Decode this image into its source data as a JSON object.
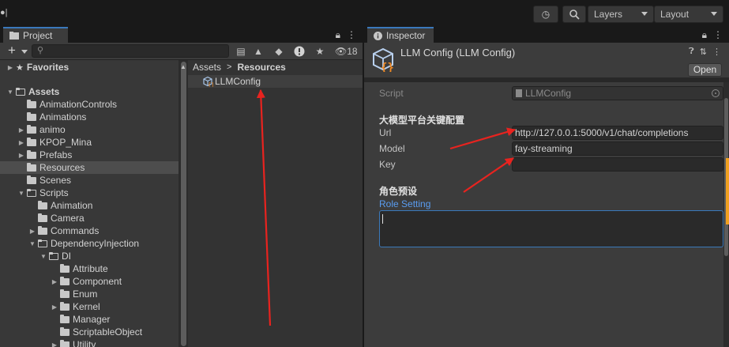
{
  "toolbar": {
    "left_glyph": "●|",
    "layers_label": "Layers",
    "layout_label": "Layout",
    "icons": [
      "history-icon",
      "search-icon"
    ]
  },
  "project": {
    "tab_label": "Project",
    "search_placeholder": "",
    "hidden_count": "18",
    "tree": [
      {
        "label": "Favorites",
        "level": 0,
        "expanded": false,
        "kind": "star",
        "bold": true
      },
      {
        "label": "Assets",
        "level": 0,
        "expanded": true,
        "kind": "folder-open",
        "bold": true
      },
      {
        "label": "AnimationControls",
        "level": 1,
        "kind": "folder"
      },
      {
        "label": "Animations",
        "level": 1,
        "kind": "folder"
      },
      {
        "label": "animo",
        "level": 1,
        "expanded": false,
        "kind": "folder"
      },
      {
        "label": "KPOP_Mina",
        "level": 1,
        "expanded": false,
        "kind": "folder"
      },
      {
        "label": "Prefabs",
        "level": 1,
        "expanded": false,
        "kind": "folder"
      },
      {
        "label": "Resources",
        "level": 1,
        "kind": "folder",
        "selected": true
      },
      {
        "label": "Scenes",
        "level": 1,
        "kind": "folder"
      },
      {
        "label": "Scripts",
        "level": 1,
        "expanded": true,
        "kind": "folder-open"
      },
      {
        "label": "Animation",
        "level": 2,
        "kind": "folder"
      },
      {
        "label": "Camera",
        "level": 2,
        "kind": "folder"
      },
      {
        "label": "Commands",
        "level": 2,
        "expanded": false,
        "kind": "folder"
      },
      {
        "label": "DependencyInjection",
        "level": 2,
        "expanded": true,
        "kind": "folder-open"
      },
      {
        "label": "DI",
        "level": 3,
        "expanded": true,
        "kind": "folder-open"
      },
      {
        "label": "Attribute",
        "level": 4,
        "kind": "folder"
      },
      {
        "label": "Component",
        "level": 4,
        "expanded": false,
        "kind": "folder"
      },
      {
        "label": "Enum",
        "level": 4,
        "kind": "folder"
      },
      {
        "label": "Kernel",
        "level": 4,
        "expanded": false,
        "kind": "folder"
      },
      {
        "label": "Manager",
        "level": 4,
        "kind": "folder"
      },
      {
        "label": "ScriptableObject",
        "level": 4,
        "kind": "folder"
      },
      {
        "label": "Utility",
        "level": 4,
        "expanded": false,
        "kind": "folder"
      }
    ],
    "breadcrumb": {
      "root": "Assets",
      "separator": ">",
      "current": "Resources"
    },
    "files": [
      {
        "label": "LLMConfig"
      }
    ]
  },
  "inspector": {
    "tab_label": "Inspector",
    "title": "LLM Config (LLM Config)",
    "open_label": "Open",
    "script_label": "Script",
    "script_value": "LLMConfig",
    "section1_title": "大模型平台关键配置",
    "url_label": "Url",
    "url_value": "http://127.0.0.1:5000/v1/chat/completions",
    "model_label": "Model",
    "model_value": "fay-streaming",
    "key_label": "Key",
    "key_value": "",
    "section2_title": "角色预设",
    "role_label": "Role Setting",
    "role_value": ""
  },
  "colors": {
    "accent_blue": "#3a79bb",
    "link_blue": "#5a9cf0",
    "annotation_red": "#e8231f",
    "orange_edge": "#f0a020"
  }
}
